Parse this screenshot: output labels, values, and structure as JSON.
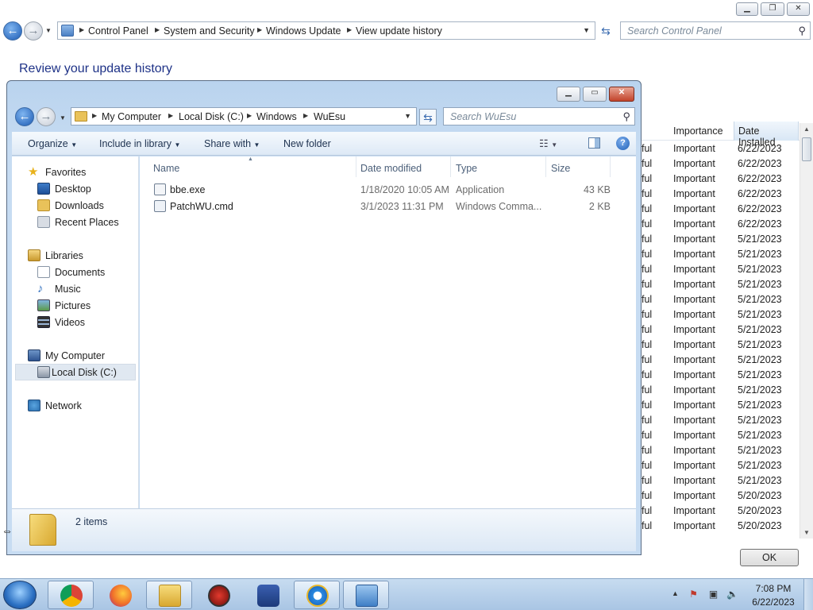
{
  "background_window": {
    "breadcrumbs": [
      "Control Panel",
      "System and Security",
      "Windows Update",
      "View update history"
    ],
    "search_placeholder": "Search Control Panel",
    "heading": "Review your update history",
    "columns": {
      "importance": "Importance",
      "date_installed": "Date Installed"
    },
    "rows": [
      {
        "status": "ful",
        "importance": "Important",
        "date": "6/22/2023"
      },
      {
        "status": "ful",
        "importance": "Important",
        "date": "6/22/2023"
      },
      {
        "status": "ful",
        "importance": "Important",
        "date": "6/22/2023"
      },
      {
        "status": "ful",
        "importance": "Important",
        "date": "6/22/2023"
      },
      {
        "status": "ful",
        "importance": "Important",
        "date": "6/22/2023"
      },
      {
        "status": "ful",
        "importance": "Important",
        "date": "6/22/2023"
      },
      {
        "status": "ful",
        "importance": "Important",
        "date": "5/21/2023"
      },
      {
        "status": "ful",
        "importance": "Important",
        "date": "5/21/2023"
      },
      {
        "status": "ful",
        "importance": "Important",
        "date": "5/21/2023"
      },
      {
        "status": "ful",
        "importance": "Important",
        "date": "5/21/2023"
      },
      {
        "status": "ful",
        "importance": "Important",
        "date": "5/21/2023"
      },
      {
        "status": "ful",
        "importance": "Important",
        "date": "5/21/2023"
      },
      {
        "status": "ful",
        "importance": "Important",
        "date": "5/21/2023"
      },
      {
        "status": "ful",
        "importance": "Important",
        "date": "5/21/2023"
      },
      {
        "status": "ful",
        "importance": "Important",
        "date": "5/21/2023"
      },
      {
        "status": "ful",
        "importance": "Important",
        "date": "5/21/2023"
      },
      {
        "status": "ful",
        "importance": "Important",
        "date": "5/21/2023"
      },
      {
        "status": "ful",
        "importance": "Important",
        "date": "5/21/2023"
      },
      {
        "status": "ful",
        "importance": "Important",
        "date": "5/21/2023"
      },
      {
        "status": "ful",
        "importance": "Important",
        "date": "5/21/2023"
      },
      {
        "status": "ful",
        "importance": "Important",
        "date": "5/21/2023"
      },
      {
        "status": "ful",
        "importance": "Important",
        "date": "5/21/2023"
      },
      {
        "status": "ful",
        "importance": "Important",
        "date": "5/21/2023"
      },
      {
        "status": "ful",
        "importance": "Important",
        "date": "5/20/2023"
      },
      {
        "status": "ful",
        "importance": "Important",
        "date": "5/20/2023"
      },
      {
        "status": "ful",
        "importance": "Important",
        "date": "5/20/2023"
      }
    ],
    "ok_label": "OK"
  },
  "explorer": {
    "breadcrumbs": [
      "My Computer",
      "Local Disk (C:)",
      "Windows",
      "WuEsu"
    ],
    "search_placeholder": "Search WuEsu",
    "toolbar": {
      "organize": "Organize",
      "include_in_library": "Include in library",
      "share_with": "Share with",
      "new_folder": "New folder"
    },
    "nav": {
      "favorites": "Favorites",
      "desktop": "Desktop",
      "downloads": "Downloads",
      "recent_places": "Recent Places",
      "libraries": "Libraries",
      "documents": "Documents",
      "music": "Music",
      "pictures": "Pictures",
      "videos": "Videos",
      "my_computer": "My Computer",
      "local_disk": "Local Disk (C:)",
      "network": "Network"
    },
    "columns": {
      "name": "Name",
      "date_modified": "Date modified",
      "type": "Type",
      "size": "Size"
    },
    "files": [
      {
        "name": "bbe.exe",
        "date": "1/18/2020 10:05 AM",
        "type": "Application",
        "size": "43 KB"
      },
      {
        "name": "PatchWU.cmd",
        "date": "3/1/2023 11:31 PM",
        "type": "Windows Comma...",
        "size": "2 KB"
      }
    ],
    "item_count": "2 items"
  },
  "taskbar": {
    "apps": [
      "chrome-icon",
      "firefox-icon",
      "file-explorer-icon",
      "app-red-icon",
      "app-blue-icon",
      "internet-explorer-icon",
      "control-panel-icon"
    ],
    "time": "7:08 PM",
    "date": "6/22/2023"
  }
}
